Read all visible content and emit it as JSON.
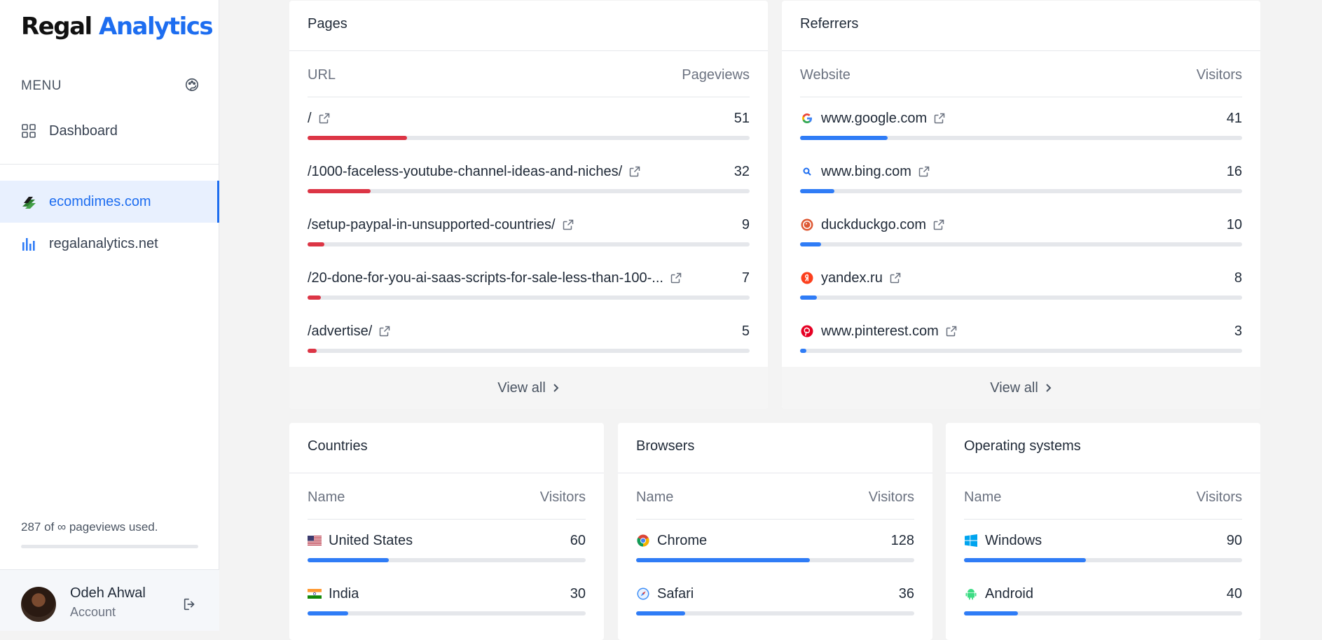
{
  "app": {
    "logo_primary": "Regal",
    "logo_accent": "Analytics",
    "brand_color": "#1d6df0"
  },
  "sidebar": {
    "menu_title": "MENU",
    "dashboard_label": "Dashboard",
    "sites": [
      {
        "label": "ecomdimes.com",
        "active": true,
        "icon": "ecomdimes-logo-icon"
      },
      {
        "label": "regalanalytics.net",
        "active": false,
        "icon": "bar-chart-icon"
      }
    ],
    "usage_text": "287 of ∞ pageviews used.",
    "account_name": "Odeh Ahwal",
    "account_sub": "Account"
  },
  "pages": {
    "title": "Pages",
    "col_left": "URL",
    "col_right": "Pageviews",
    "footer": "View all",
    "rows": [
      {
        "label": "/",
        "value": "51",
        "fraction": 0.225
      },
      {
        "label": "/1000-faceless-youtube-channel-ideas-and-niches/",
        "value": "32",
        "fraction": 0.142
      },
      {
        "label": "/setup-paypal-in-unsupported-countries/",
        "value": "9",
        "fraction": 0.038
      },
      {
        "label": "/20-done-for-you-ai-saas-scripts-for-sale-less-than-100-...",
        "value": "7",
        "fraction": 0.03
      },
      {
        "label": "/advertise/",
        "value": "5",
        "fraction": 0.021
      }
    ]
  },
  "referrers": {
    "title": "Referrers",
    "col_left": "Website",
    "col_right": "Visitors",
    "footer": "View all",
    "rows": [
      {
        "label": "www.google.com",
        "value": "41",
        "fraction": 0.198,
        "icon": "google-icon"
      },
      {
        "label": "www.bing.com",
        "value": "16",
        "fraction": 0.077,
        "icon": "bing-search-icon"
      },
      {
        "label": "duckduckgo.com",
        "value": "10",
        "fraction": 0.048,
        "icon": "duckduckgo-icon"
      },
      {
        "label": "yandex.ru",
        "value": "8",
        "fraction": 0.038,
        "icon": "yandex-icon"
      },
      {
        "label": "www.pinterest.com",
        "value": "3",
        "fraction": 0.014,
        "icon": "pinterest-icon"
      }
    ]
  },
  "countries": {
    "title": "Countries",
    "col_left": "Name",
    "col_right": "Visitors",
    "rows": [
      {
        "label": "United States",
        "value": "60",
        "fraction": 0.293,
        "icon": "us-flag-icon"
      },
      {
        "label": "India",
        "value": "30",
        "fraction": 0.147,
        "icon": "india-flag-icon"
      }
    ]
  },
  "browsers": {
    "title": "Browsers",
    "col_left": "Name",
    "col_right": "Visitors",
    "rows": [
      {
        "label": "Chrome",
        "value": "128",
        "fraction": 0.624,
        "icon": "chrome-icon"
      },
      {
        "label": "Safari",
        "value": "36",
        "fraction": 0.176,
        "icon": "safari-icon"
      }
    ]
  },
  "os": {
    "title": "Operating systems",
    "col_left": "Name",
    "col_right": "Visitors",
    "rows": [
      {
        "label": "Windows",
        "value": "90",
        "fraction": 0.439,
        "icon": "windows-icon"
      },
      {
        "label": "Android",
        "value": "40",
        "fraction": 0.195,
        "icon": "android-icon"
      }
    ]
  }
}
